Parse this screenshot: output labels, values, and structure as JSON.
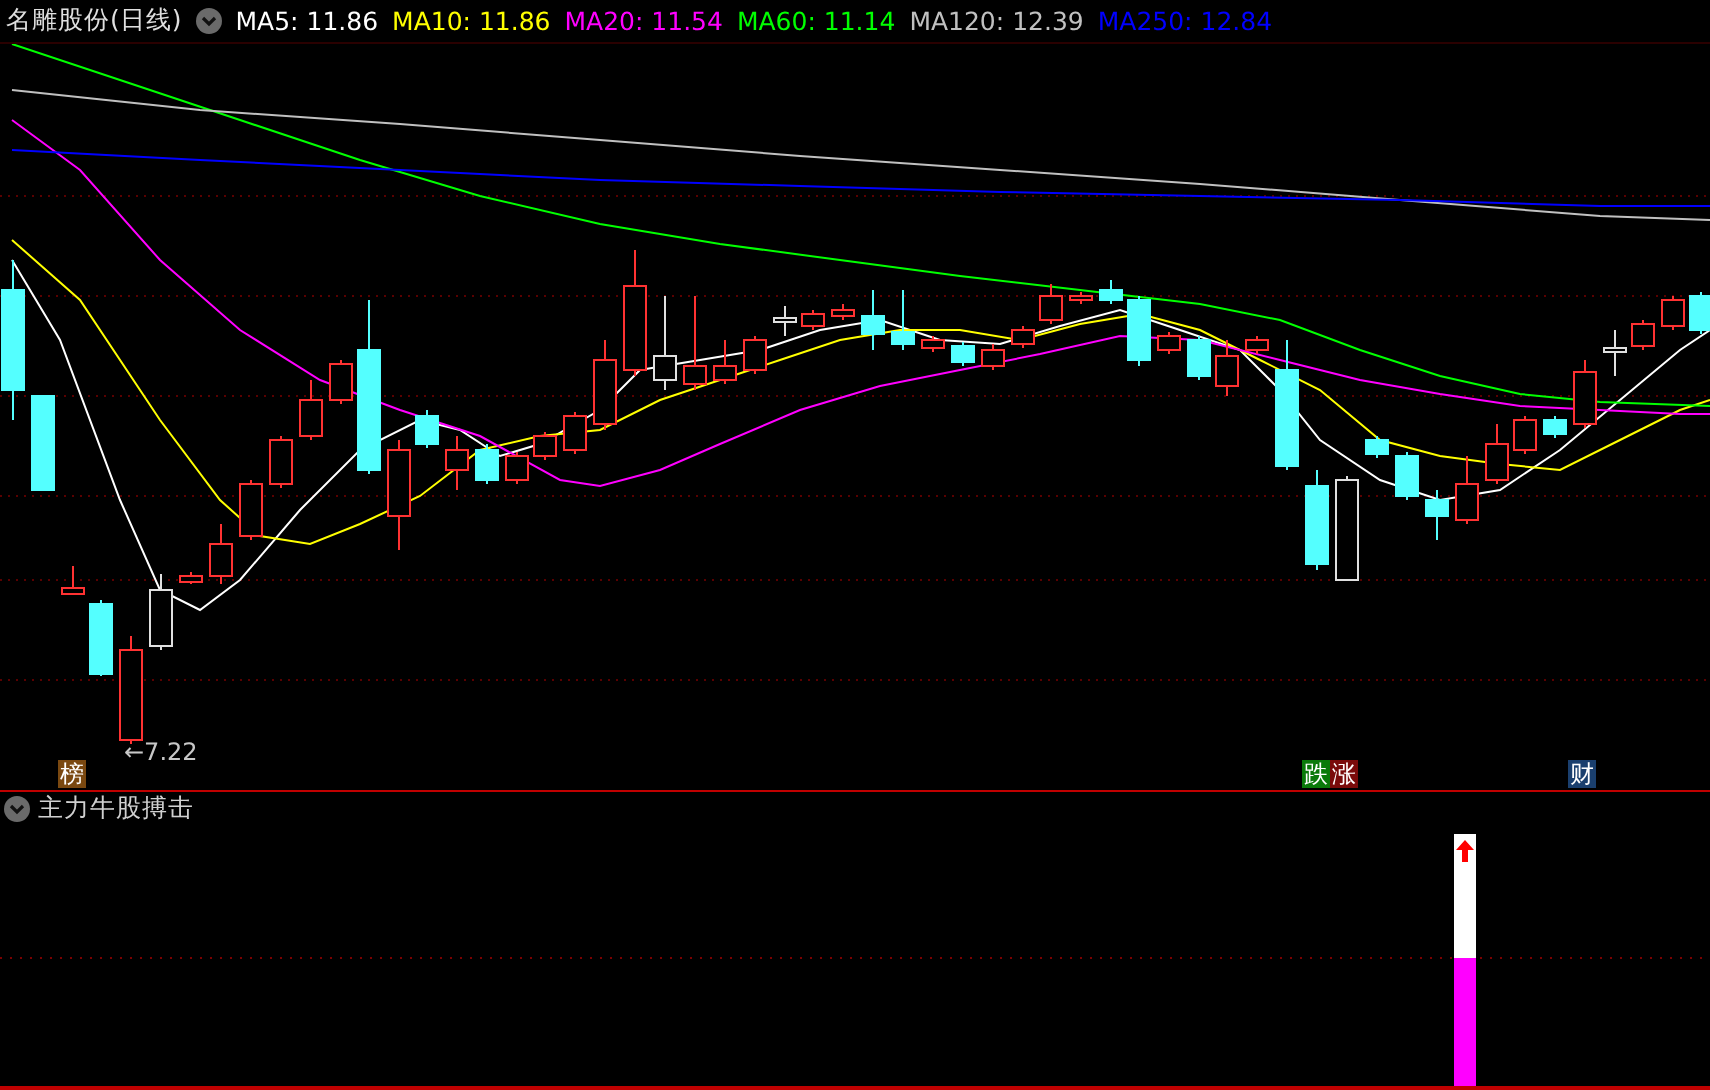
{
  "header": {
    "title": "名雕股份(日线)",
    "indicators": [
      {
        "label": "MA5: 11.86",
        "color": "#ffffff"
      },
      {
        "label": "MA10: 11.86",
        "color": "#ffff00"
      },
      {
        "label": "MA20: 11.54",
        "color": "#ff00ff"
      },
      {
        "label": "MA60: 11.14",
        "color": "#00ff00"
      },
      {
        "label": "MA120: 12.39",
        "color": "#c0c0c0"
      },
      {
        "label": "MA250: 12.84",
        "color": "#0000ff"
      }
    ]
  },
  "low_label": "←7.22",
  "event_markers": [
    {
      "text": "榜",
      "color": "#7a4810"
    },
    {
      "text": "跌",
      "color": "#0a7a0a"
    },
    {
      "text": "涨",
      "color": "#7a0a0a"
    },
    {
      "text": "财",
      "color": "#1a3f6e"
    }
  ],
  "indicator_panel": {
    "title": "主力牛股搏击"
  }
}
